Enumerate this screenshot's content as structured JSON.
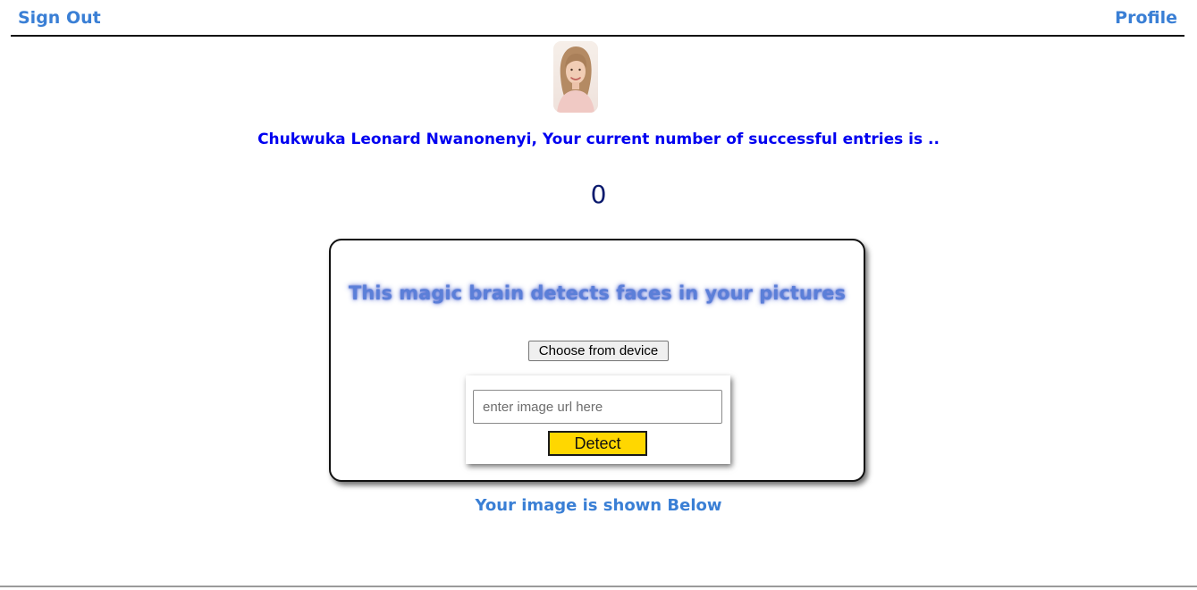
{
  "nav": {
    "sign_out": "Sign Out",
    "profile": "Profile"
  },
  "user": {
    "avatar_icon": "user-portrait-photo",
    "greeting": "Chukwuka Leonard Nwanonenyi, Your current number of successful entries is ..",
    "entries_count": "0"
  },
  "detector": {
    "title": "This magic brain detects faces in your pictures",
    "choose_label": "Choose from device",
    "url_placeholder": "enter image url here",
    "url_value": "",
    "detect_label": "Detect"
  },
  "result": {
    "caption": "Your image is shown Below"
  },
  "colors": {
    "link": "#3a7fd5",
    "greeting": "#0000f0",
    "count": "#0b1a6e",
    "detect_button": "#ffd700"
  }
}
